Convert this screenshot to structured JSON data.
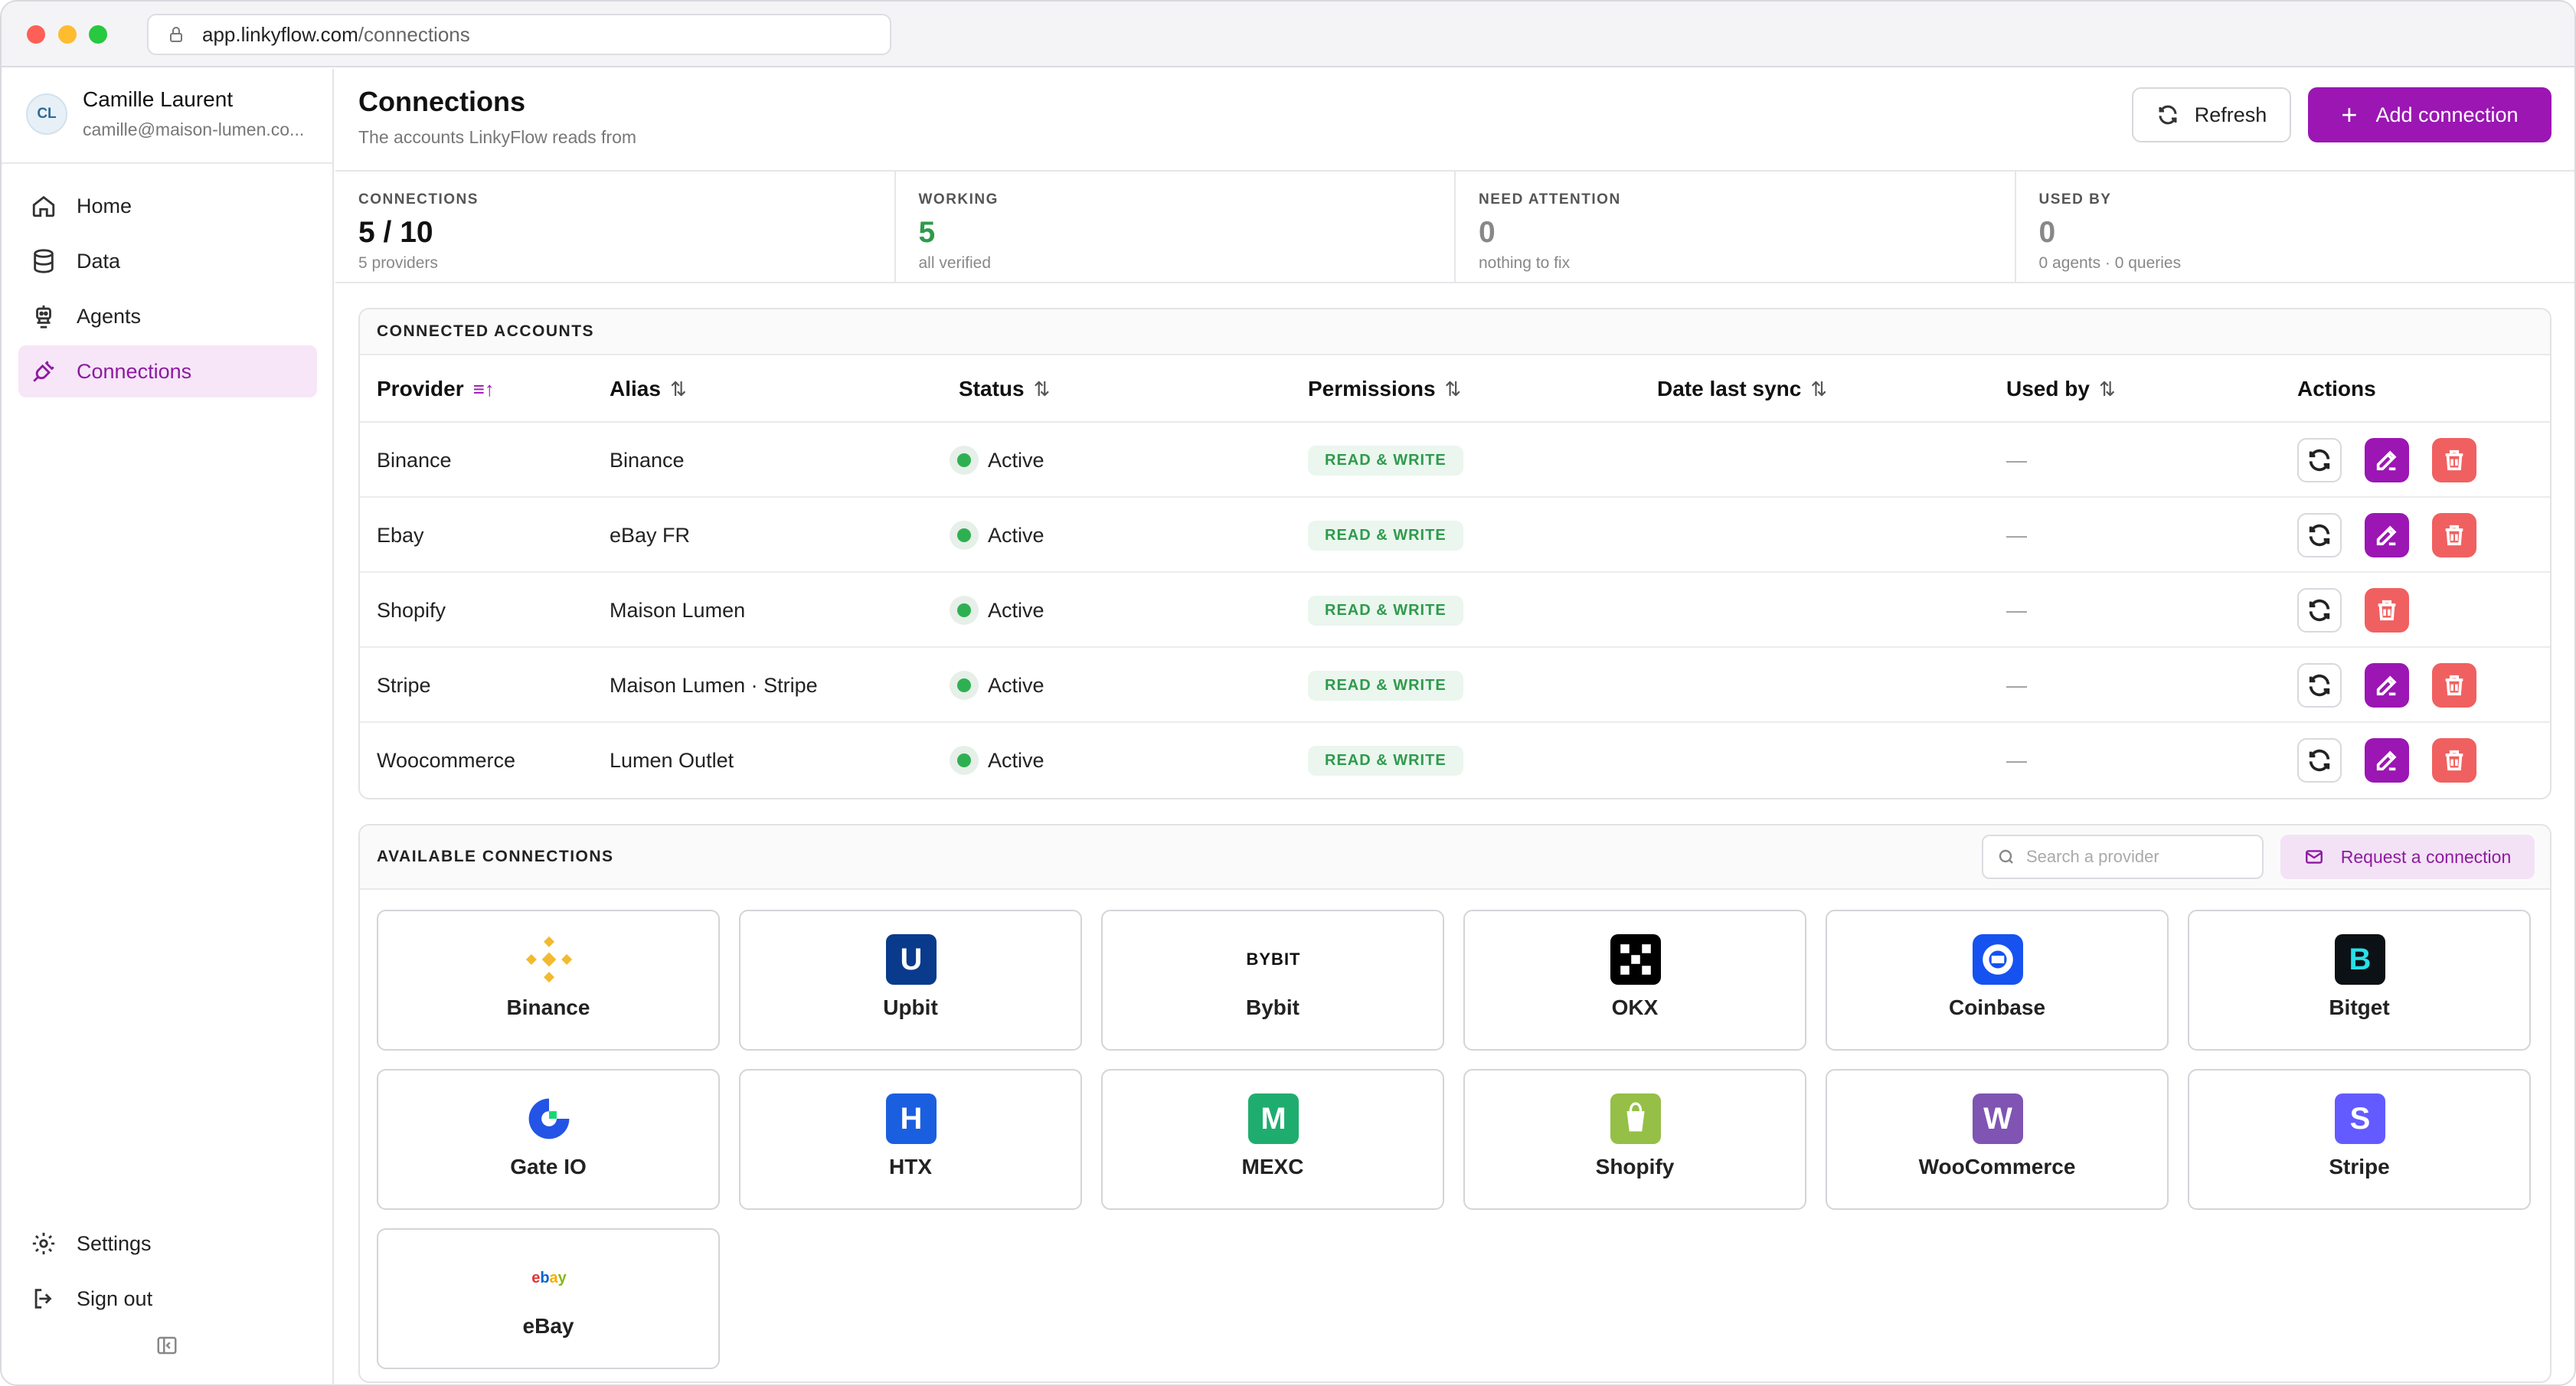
{
  "browser": {
    "url_domain": "app.linkyflow.com",
    "url_path": "/connections"
  },
  "profile": {
    "initials": "CL",
    "name": "Camille Laurent",
    "email": "camille@maison-lumen.co..."
  },
  "nav": {
    "items": [
      {
        "label": "Home",
        "icon": "home-icon"
      },
      {
        "label": "Data",
        "icon": "database-icon"
      },
      {
        "label": "Agents",
        "icon": "robot-icon"
      },
      {
        "label": "Connections",
        "icon": "plug-icon",
        "active": true
      }
    ],
    "bottom": [
      {
        "label": "Settings",
        "icon": "gear-icon"
      },
      {
        "label": "Sign out",
        "icon": "sign-out-icon"
      }
    ]
  },
  "header": {
    "title": "Connections",
    "subtitle": "The accounts LinkyFlow reads from",
    "refresh_label": "Refresh",
    "add_label": "Add connection"
  },
  "stats": [
    {
      "label": "CONNECTIONS",
      "value": "5 / 10",
      "sub": "5 providers",
      "tone": "default"
    },
    {
      "label": "WORKING",
      "value": "5",
      "sub": "all verified",
      "tone": "green"
    },
    {
      "label": "NEED ATTENTION",
      "value": "0",
      "sub": "nothing to fix",
      "tone": "grey"
    },
    {
      "label": "USED BY",
      "value": "0",
      "sub": "0 agents · 0 queries",
      "tone": "grey"
    }
  ],
  "connected": {
    "heading": "CONNECTED ACCOUNTS",
    "columns": [
      "Provider",
      "Alias",
      "Status",
      "Permissions",
      "Date last sync",
      "Used by",
      "Actions"
    ],
    "rows": [
      {
        "provider": "Binance",
        "alias": "Binance",
        "status": "Active",
        "permission": "READ & WRITE",
        "last_sync": "",
        "used_by": "—",
        "editable": true
      },
      {
        "provider": "Ebay",
        "alias": "eBay FR",
        "status": "Active",
        "permission": "READ & WRITE",
        "last_sync": "",
        "used_by": "—",
        "editable": true
      },
      {
        "provider": "Shopify",
        "alias": "Maison Lumen",
        "status": "Active",
        "permission": "READ & WRITE",
        "last_sync": "",
        "used_by": "—",
        "editable": false
      },
      {
        "provider": "Stripe",
        "alias": "Maison Lumen · Stripe",
        "status": "Active",
        "permission": "READ & WRITE",
        "last_sync": "",
        "used_by": "—",
        "editable": true
      },
      {
        "provider": "Woocommerce",
        "alias": "Lumen Outlet",
        "status": "Active",
        "permission": "READ & WRITE",
        "last_sync": "",
        "used_by": "—",
        "editable": true
      }
    ]
  },
  "available": {
    "heading": "AVAILABLE CONNECTIONS",
    "search_placeholder": "Search a provider",
    "request_label": "Request a connection",
    "providers": [
      {
        "name": "Binance",
        "logo": "binance-logo",
        "color": "#f3ba2f"
      },
      {
        "name": "Upbit",
        "logo": "upbit-logo",
        "mark": "U",
        "color": "#0a3a8c"
      },
      {
        "name": "Bybit",
        "logo": "bybit-logo",
        "mark": "BYBIT",
        "color": "#111111"
      },
      {
        "name": "OKX",
        "logo": "okx-logo",
        "color": "#000000"
      },
      {
        "name": "Coinbase",
        "logo": "coinbase-logo",
        "color": "#1652f0"
      },
      {
        "name": "Bitget",
        "logo": "bitget-logo",
        "mark": "B",
        "color": "#0c1116"
      },
      {
        "name": "Gate IO",
        "logo": "gate-io-logo",
        "color": "#2354e6"
      },
      {
        "name": "HTX",
        "logo": "htx-logo",
        "mark": "H",
        "color": "#1a5fe0"
      },
      {
        "name": "MEXC",
        "logo": "mexc-logo",
        "mark": "M",
        "color": "#1fad6f"
      },
      {
        "name": "Shopify",
        "logo": "shopify-logo",
        "color": "#95bf47"
      },
      {
        "name": "WooCommerce",
        "logo": "woocommerce-logo",
        "mark": "W",
        "color": "#7f54b3"
      },
      {
        "name": "Stripe",
        "logo": "stripe-logo",
        "mark": "S",
        "color": "#635bff"
      },
      {
        "name": "eBay",
        "logo": "ebay-logo",
        "mark": "ebay",
        "color": "#e53238"
      }
    ]
  },
  "colors": {
    "accent": "#9b16b3",
    "success": "#2e9a4a",
    "danger": "#f06060"
  }
}
